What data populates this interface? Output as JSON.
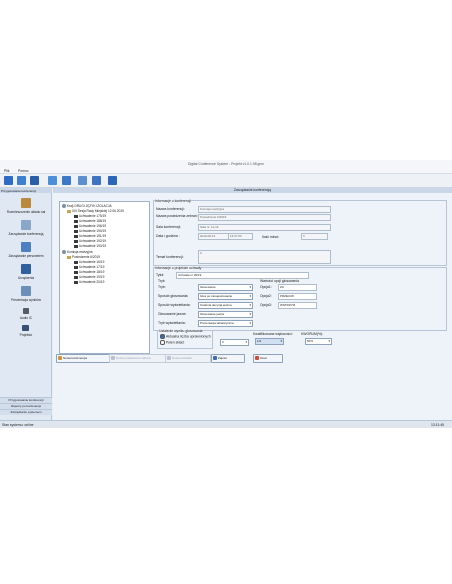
{
  "window": {
    "title": "Digital Conference System - Projekt v1.0.1.98.gmx"
  },
  "menu": [
    "Plik",
    "Pomoc"
  ],
  "left_panel": {
    "header": "Przygotowanie konferencji",
    "items": [
      {
        "label": "Rozmieszczenie układu sal"
      },
      {
        "label": "Zarządzanie konferencją"
      },
      {
        "label": "Zarządzanie personelem"
      },
      {
        "label": "Urządzenia"
      },
      {
        "label": "Prezentacja wyników"
      },
      {
        "label": "Audio IC"
      },
      {
        "label": "Projektor"
      }
    ],
    "bottom_tabs": [
      "Przygotowanie konferencji",
      "Raporty po konferencji",
      "Zarządzanie systemem"
    ]
  },
  "main": {
    "header": "Zarządzanie konferencją",
    "tree": {
      "root": "Kraj\\ DRUGI JĘZYK IZOLACJA",
      "conf1": "XIII Sesja Rady Miejskiej 12.06.2019",
      "conf1_items": [
        "Uchwalenie 175/19",
        "Uchwalenie 188/19",
        "Uchwalenie 196/19",
        "Uchwalenie 190/19",
        "Uchwalenie 191/19",
        "Uchwalenie 192/19",
        "Uchwalenie 193/19"
      ],
      "conf2": "Komisja rewizyjna",
      "conf2_sub": "Posiedzenie 6/2019",
      "conf2_items": [
        "Uchwalenie 16/19",
        "Uchwalenie 17/19",
        "Uchwalenie 18/19",
        "Uchwalenie 19/19",
        "Uchwalenie 20/19"
      ]
    },
    "info": {
      "group_title": "Informacje o konferencji",
      "name_label": "Nazwa konferencji:",
      "name_value": "Komisja rewizyjna",
      "session_label": "Nazwa posiedzenia zebrań:",
      "session_value": "Posiedzenie 6/2019",
      "room_label": "Sala konferencji:",
      "room_value": "Sala nr. 11-16",
      "date_label": "Data i godzina :",
      "date_value": "2019-06-12",
      "time_value": "13:07:00",
      "duration_label": "Ilość minut:",
      "duration_value": "0",
      "topic_label": "Temat konferencji:",
      "topic_value": "0"
    },
    "vote": {
      "group_title": "Informacje o projekcie uchwały",
      "title_label": "Tytuł:",
      "title_value": "Uchwała nr 20/19",
      "subgroup_label": "Tryb",
      "mode_label": "Tryb:",
      "mode_value": "Głosowanie",
      "voting_label": "Sposób głosowania:",
      "voting_value": "Głos po zarejestrowaniu",
      "display_label": "Sposób wyświetlania:",
      "display_value": "Ostatnia decyzja ważna",
      "secret_label": "Głosowanie jawne:",
      "secret_value": "Głosowanie jawne",
      "show_label": "Tryb wyświetlania:",
      "show_value": "Prezentacja tabelaryczna",
      "right_title": "Wartości opcji głosowania",
      "opt1_label": "Opcja1:",
      "opt1_value": "ZA",
      "opt2_label": "Opcja2:",
      "opt2_value": "PRZECIW",
      "opt3_label": "Opcja3:",
      "opt3_value": "WSTRZYM"
    },
    "result": {
      "group_title": "Ustalenie wyniku głosowania",
      "radio1": "Aktualna liczba uprawnionych",
      "radio2": "Pełen skład:",
      "radio2_value": "0",
      "qual_label": "Kwalifikowane większości:",
      "qual_value": "1/2",
      "quorum_label": "KWORUM(%):",
      "quorum_value": "50%"
    },
    "buttons": {
      "new_conf": "Nowa konferencja",
      "new_session": "Nowe posiedzenie zebrań",
      "new_resolution": "Nowa uchwała",
      "save": "Zapisz",
      "delete": "Usuń"
    }
  },
  "status": {
    "left": "Stan systemu: online",
    "right": "13:11:45"
  },
  "colors": {
    "accent": "#3a6db5",
    "panel": "#dfe8f3",
    "header": "#c9d7e8"
  }
}
